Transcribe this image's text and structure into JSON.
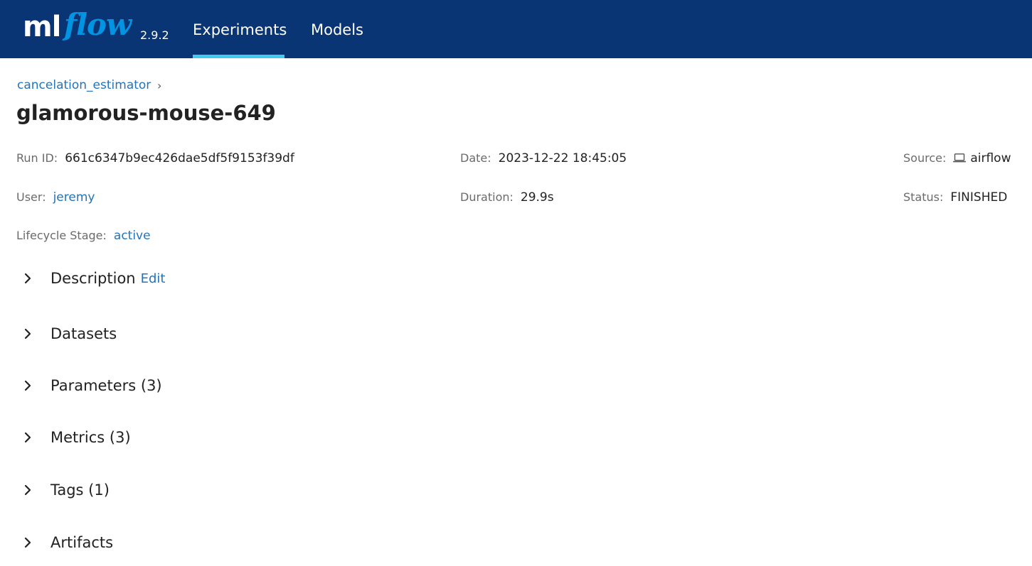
{
  "header": {
    "logo_ml": "ml",
    "logo_flow": "flow",
    "version": "2.9.2",
    "tabs": [
      {
        "label": "Experiments",
        "active": true
      },
      {
        "label": "Models",
        "active": false
      }
    ],
    "bg_color": "#0a3575",
    "accent_color": "#43c9ed"
  },
  "breadcrumb": {
    "experiment": "cancelation_estimator",
    "separator": "›"
  },
  "run": {
    "title": "glamorous-mouse-649",
    "run_id_label": "Run ID:",
    "run_id": "661c6347b9ec426dae5df5f9153f39df",
    "date_label": "Date:",
    "date": "2023-12-22 18:45:05",
    "source_label": "Source:",
    "source_icon": "laptop-icon",
    "source": "airflow",
    "user_label": "User:",
    "user": "jeremy",
    "duration_label": "Duration:",
    "duration": "29.9s",
    "status_label": "Status:",
    "status": "FINISHED",
    "lifecycle_label": "Lifecycle Stage:",
    "lifecycle": "active"
  },
  "sections": {
    "description": "Description",
    "description_edit": "Edit",
    "datasets": "Datasets",
    "parameters": "Parameters (3)",
    "metrics": "Metrics (3)",
    "tags": "Tags (1)",
    "artifacts": "Artifacts"
  },
  "colors": {
    "link": "#2374bb"
  }
}
